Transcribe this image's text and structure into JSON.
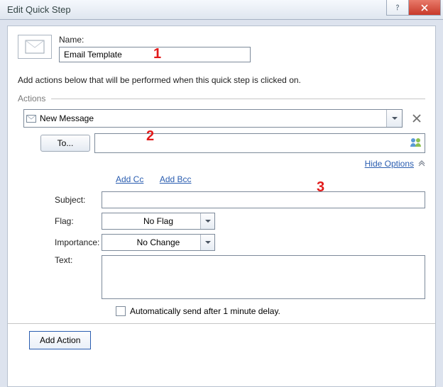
{
  "window": {
    "title": "Edit Quick Step"
  },
  "name_section": {
    "label": "Name:",
    "value": "Email Template"
  },
  "instruction": "Add actions below that will be performed when this quick step is clicked on.",
  "actions_label": "Actions",
  "action": {
    "selected": "New Message"
  },
  "to_button": "To...",
  "hide_options": "Hide Options",
  "cc_links": {
    "add_cc": "Add Cc",
    "add_bcc": "Add Bcc"
  },
  "fields": {
    "subject_label": "Subject:",
    "subject_value": "",
    "flag_label": "Flag:",
    "flag_value": "No Flag",
    "importance_label": "Importance:",
    "importance_value": "No Change",
    "text_label": "Text:",
    "text_value": "",
    "auto_send": "Automatically send after 1 minute delay."
  },
  "add_action": "Add Action",
  "annotations": {
    "1": "1",
    "2": "2",
    "3": "3"
  }
}
